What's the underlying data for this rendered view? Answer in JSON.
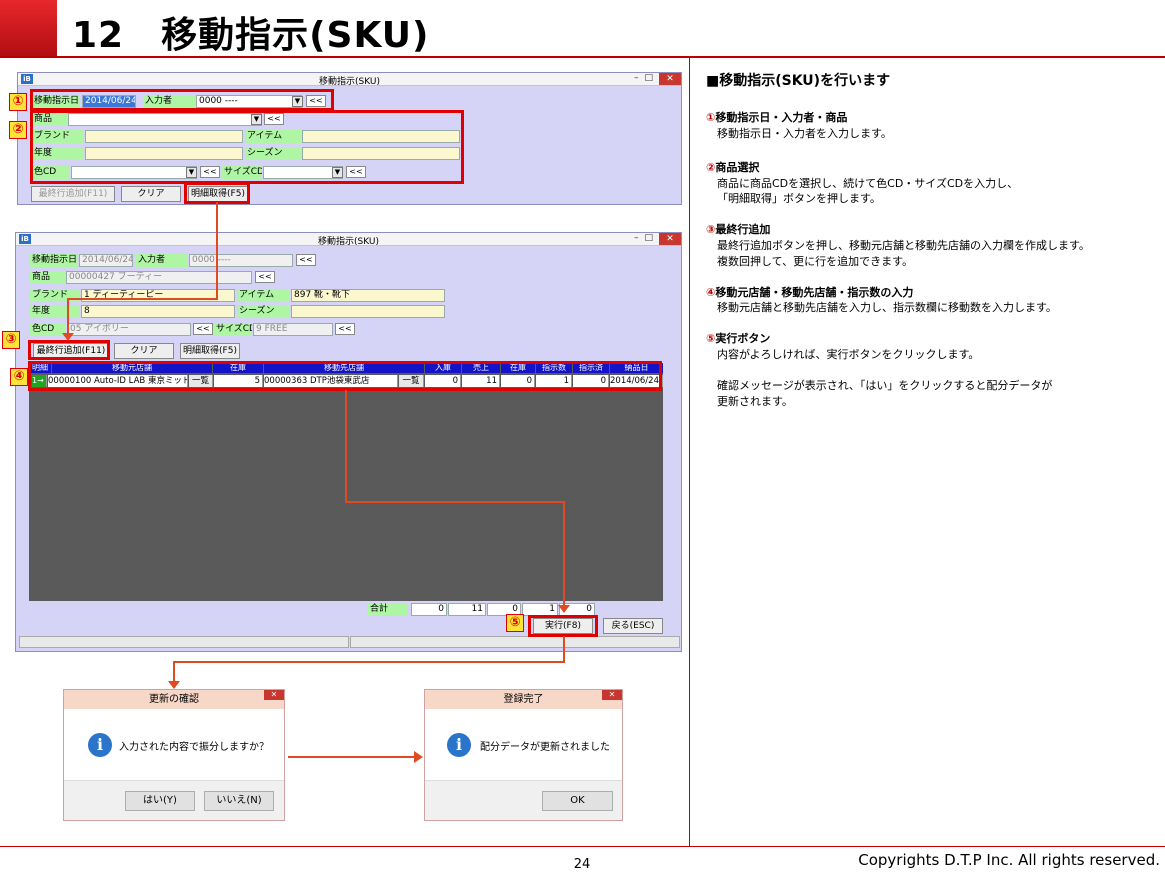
{
  "header": {
    "title": "12　移動指示(SKU)"
  },
  "footer": {
    "page": "24",
    "copyright": "Copyrights  D.T.P Inc. All rights reserved."
  },
  "win1": {
    "title": "移動指示(SKU)",
    "date_label": "移動指示日",
    "date_value": "2014/06/24",
    "inputter_label": "入力者",
    "inputter_value": "0000 ----",
    "product_label": "商品",
    "brand_label": "ブランド",
    "item_label": "アイテム",
    "year_label": "年度",
    "season_label": "シーズン",
    "color_label": "色CD",
    "size_label": "サイズCD",
    "prev": "<<",
    "btn_last_row": "最終行追加(F11)",
    "btn_clear": "クリア",
    "btn_detail": "明細取得(F5)"
  },
  "win2": {
    "title": "移動指示(SKU)",
    "date_label": "移動指示日",
    "date_value": "2014/06/24",
    "inputter_label": "入力者",
    "inputter_value": "0000 ----",
    "product_label": "商品",
    "product_value": "00000427 ブーティー",
    "brand_label": "ブランド",
    "brand_value": "1 ディーティーピー",
    "item_label": "アイテム",
    "item_value": "897 靴・靴下",
    "year_label": "年度",
    "year_value": "8",
    "season_label": "シーズン",
    "color_label": "色CD",
    "color_value": "05 アイボリー",
    "size_label": "サイズCD",
    "size_value": "9 FREE",
    "prev": "<<",
    "btn_last_row": "最終行追加(F11)",
    "btn_clear": "クリア",
    "btn_detail": "明細取得(F5)",
    "grid_headers": [
      "明細",
      "移動元店舗",
      "在庫",
      "移動先店舗",
      "入庫",
      "売上",
      "在庫",
      "指示数",
      "指示済",
      "納品日"
    ],
    "row": {
      "seq": "1",
      "from_store": "00000100 Auto-ID LAB 東京ミッドタ",
      "list_btn": "一覧",
      "stock": "5",
      "to_store": "00000363 DTP池袋東武店",
      "list_btn2": "一覧",
      "in": "0",
      "sales": "11",
      "stock2": "0",
      "qty": "1",
      "done": "0",
      "date": "2014/06/24"
    },
    "total_label": "合計",
    "totals": [
      "0",
      "11",
      "0",
      "1",
      "0"
    ],
    "btn_exec": "実行(F8)",
    "btn_back": "戻る(ESC)"
  },
  "dialog1": {
    "title": "更新の確認",
    "message": "入力された内容で振分しますか？",
    "yes": "はい(Y)",
    "no": "いいえ(N)"
  },
  "dialog2": {
    "title": "登録完了",
    "message": "配分データが更新されました",
    "ok": "OK"
  },
  "markers": [
    "①",
    "②",
    "③",
    "④",
    "⑤"
  ],
  "right_panel": {
    "heading": "■移動指示(SKU)を行います",
    "s1_title": "移動指示日・入力者・商品",
    "s1_circ": "①",
    "s1_body": "移動指示日・入力者を入力します。",
    "s2_title": "商品選択",
    "s2_circ": "②",
    "s2_body1": "商品に商品CDを選択し、続けて色CD・サイズCDを入力し、",
    "s2_body2": "「明細取得」ボタンを押します。",
    "s3_title": "最終行追加",
    "s3_circ": "③",
    "s3_body1": "最終行追加ボタンを押し、移動元店舗と移動先店舗の入力欄を作成します。",
    "s3_body2": "複数回押して、更に行を追加できます。",
    "s4_title": "移動元店舗・移動先店舗・指示数の入力",
    "s4_circ": "④",
    "s4_body": "移動元店舗と移動先店舗を入力し、指示数欄に移動数を入力します。",
    "s5_title": "実行ボタン",
    "s5_circ": "⑤",
    "s5_body1": "内容がよろしければ、実行ボタンをクリックします。",
    "s5_body2": "確認メッセージが表示され、「はい」をクリックすると配分データが",
    "s5_body3": "更新されます。"
  }
}
